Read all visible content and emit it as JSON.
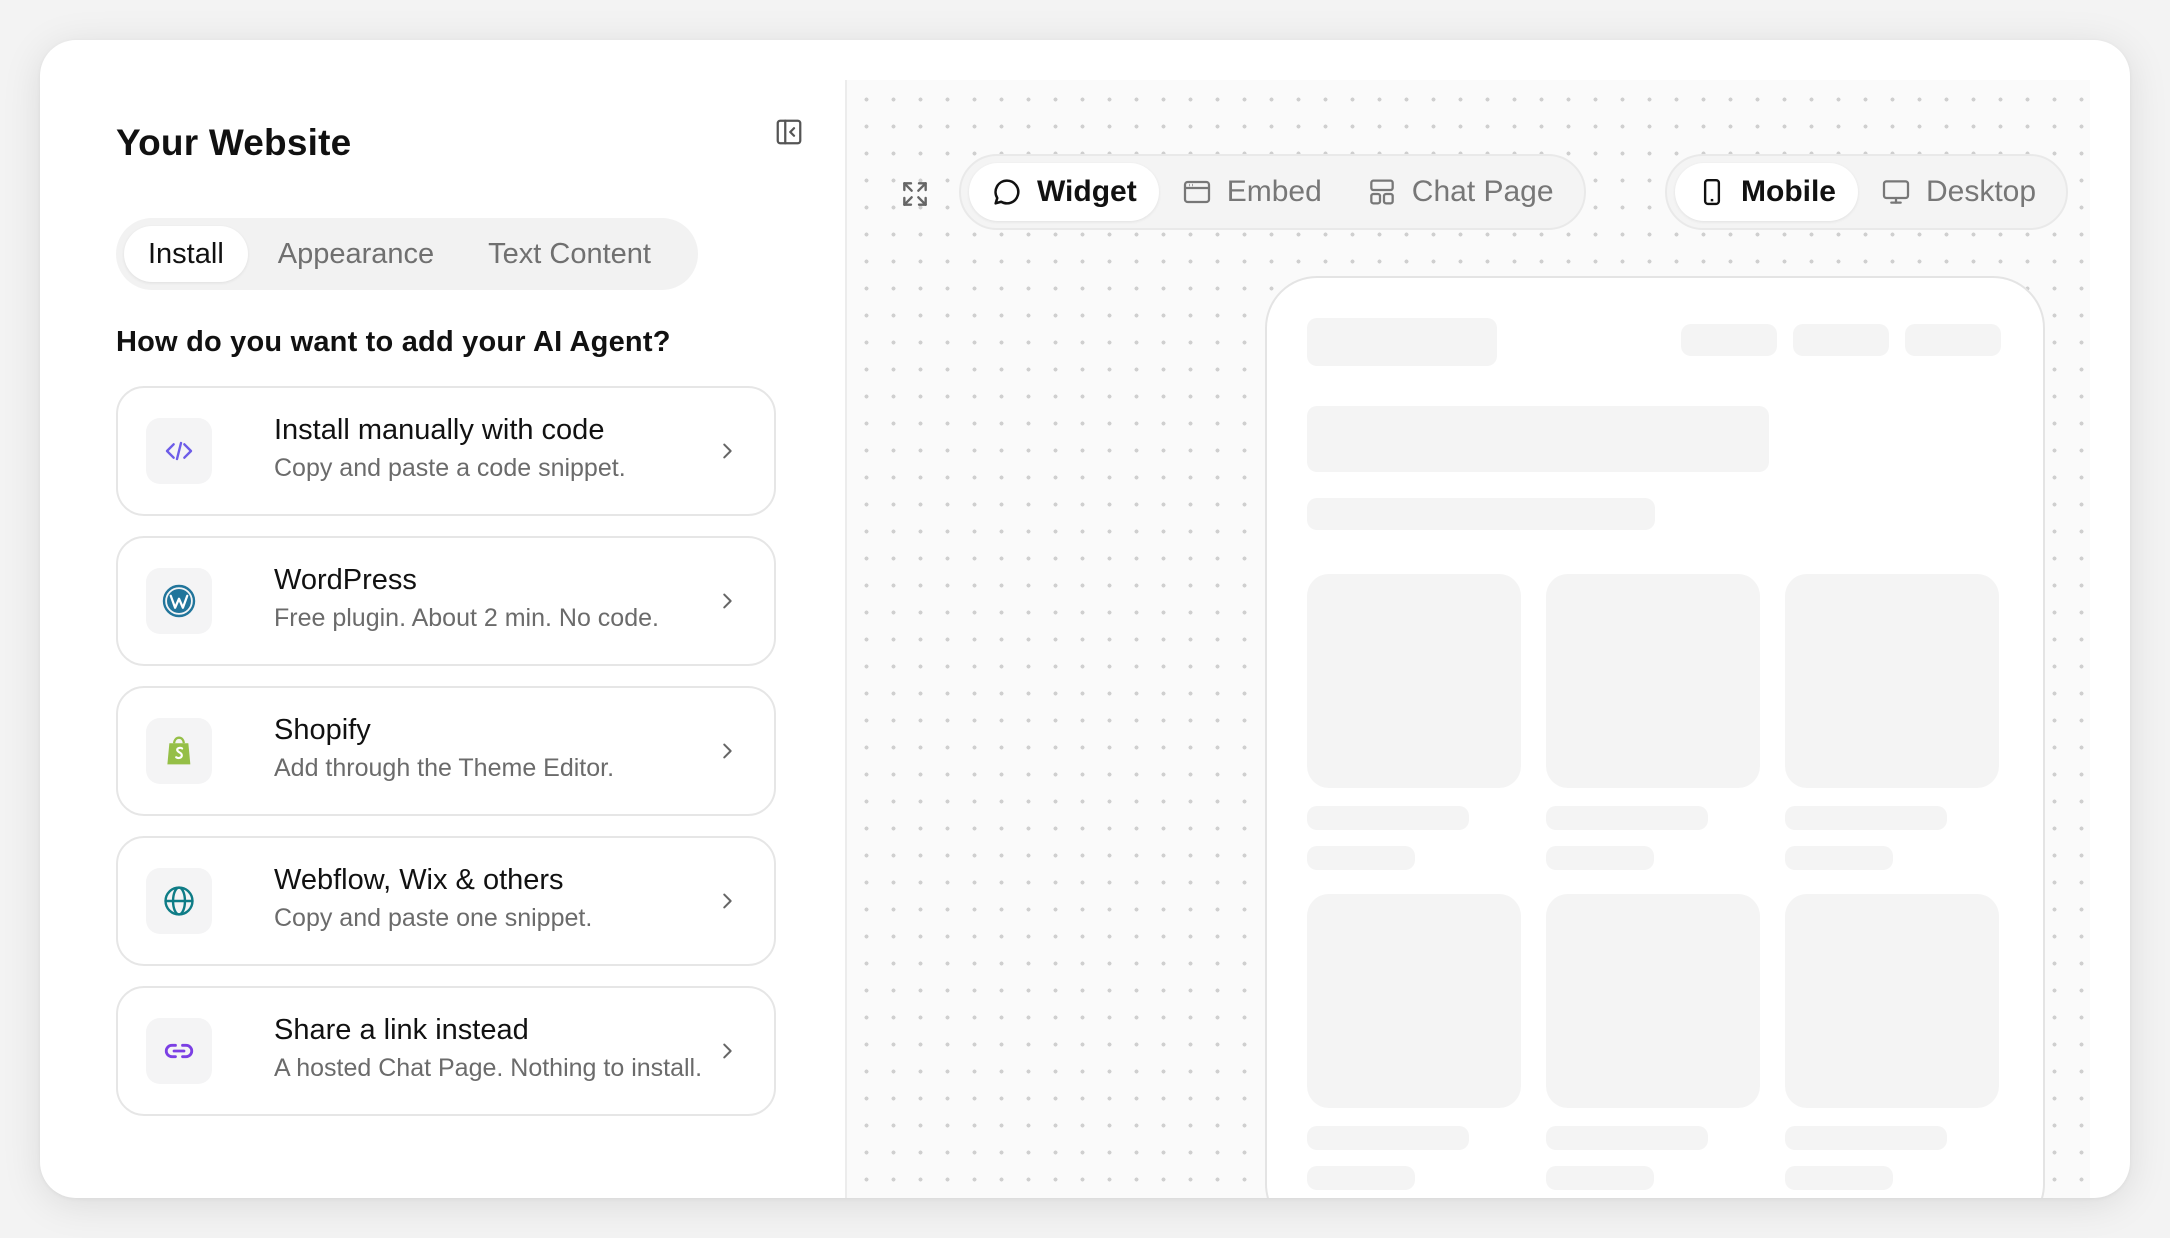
{
  "panel": {
    "title": "Your Website",
    "tabs": [
      {
        "label": "Install",
        "active": true
      },
      {
        "label": "Appearance",
        "active": false
      },
      {
        "label": "Text Content",
        "active": false
      }
    ],
    "question": "How do you want to add your AI Agent?",
    "options": [
      {
        "title": "Install manually with code",
        "description": "Copy and paste a code snippet.",
        "icon": "code-icon"
      },
      {
        "title": "WordPress",
        "description": "Free plugin. About 2 min. No code.",
        "icon": "wordpress-icon"
      },
      {
        "title": "Shopify",
        "description": "Add through the Theme Editor.",
        "icon": "shopify-icon"
      },
      {
        "title": "Webflow, Wix & others",
        "description": "Copy and paste one snippet.",
        "icon": "globe-icon"
      },
      {
        "title": "Share a link instead",
        "description": "A hosted Chat Page. Nothing to install.",
        "icon": "link-icon"
      }
    ]
  },
  "preview": {
    "modes": [
      {
        "label": "Widget",
        "icon": "chat-bubble-icon",
        "active": true
      },
      {
        "label": "Embed",
        "icon": "browser-window-icon",
        "active": false
      },
      {
        "label": "Chat Page",
        "icon": "layout-icon",
        "active": false
      }
    ],
    "devices": [
      {
        "label": "Mobile",
        "icon": "smartphone-icon",
        "active": true
      },
      {
        "label": "Desktop",
        "icon": "monitor-icon",
        "active": false
      }
    ]
  },
  "colors": {
    "code_icon": "#6d5ce8",
    "wordpress_icon": "#21759b",
    "shopify_icon": "#95bf47",
    "globe_icon": "#0e7c86",
    "link_icon": "#7b3fe4"
  }
}
